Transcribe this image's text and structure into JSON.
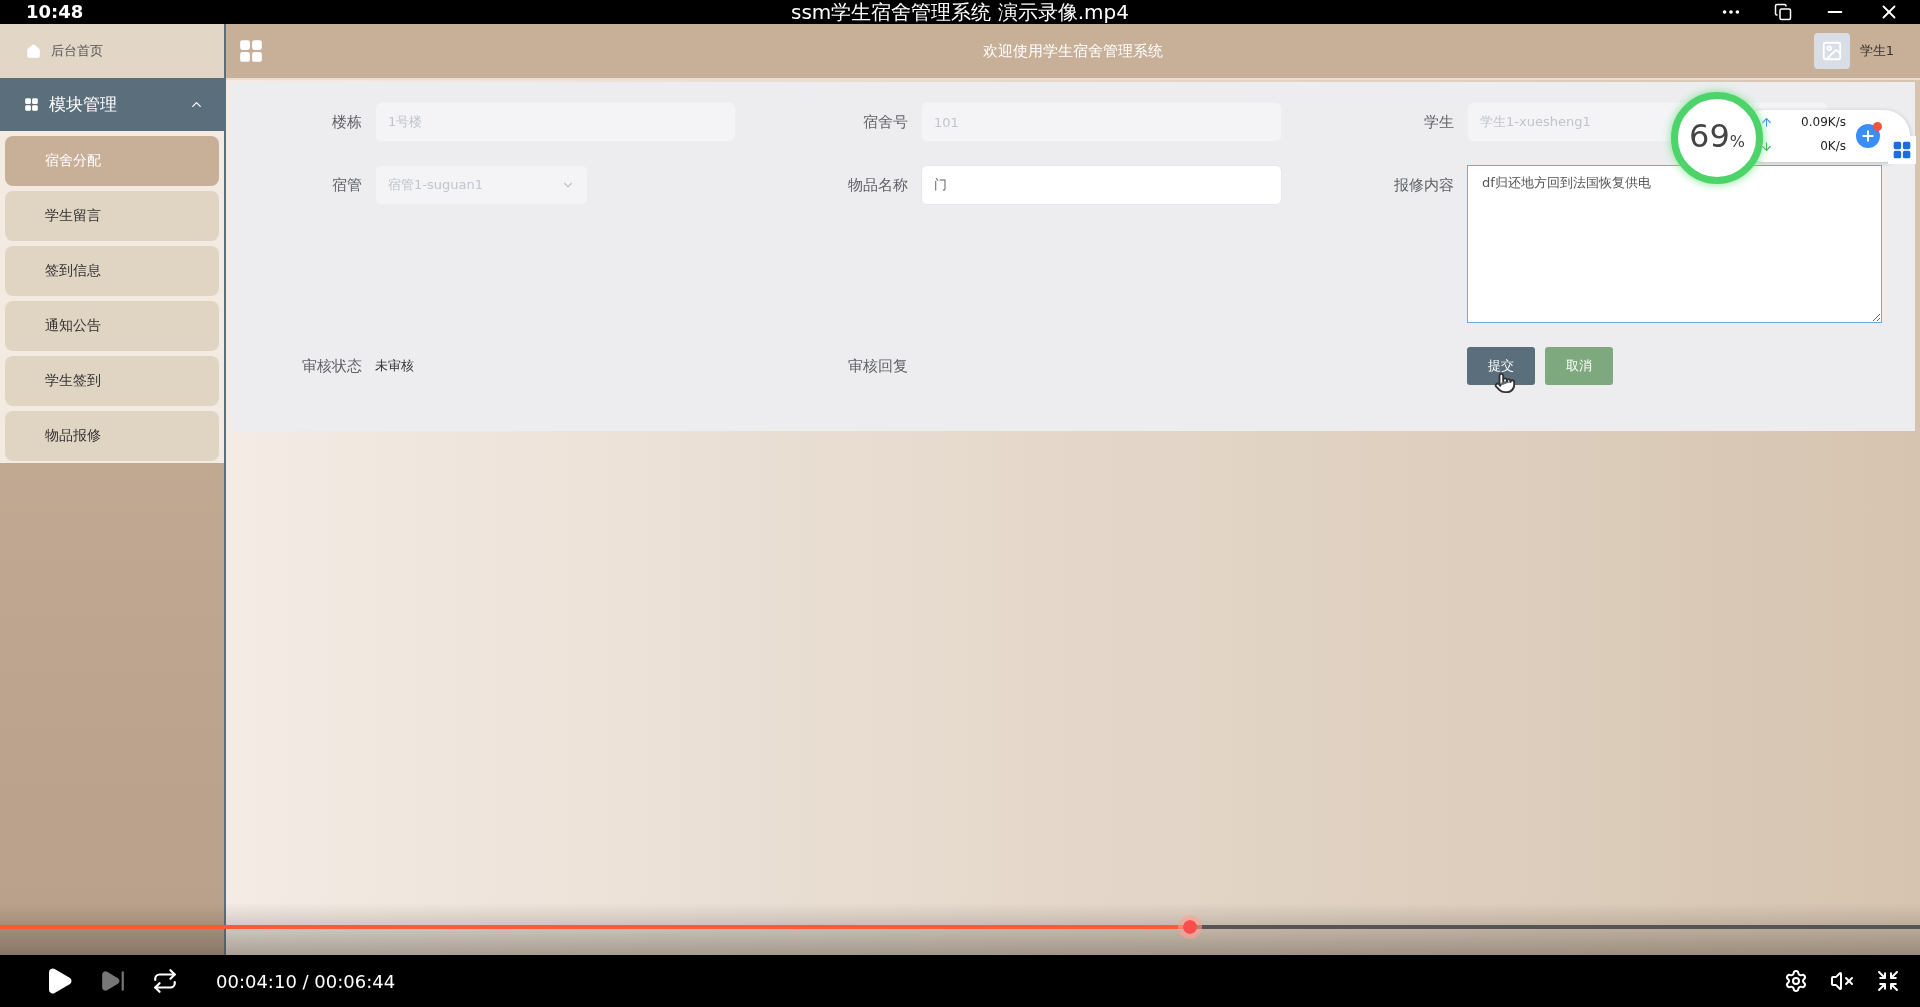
{
  "player": {
    "clock": "10:48",
    "title": "ssm学生宿舍管理系统 演示录像.mp4",
    "time": "00:04:10 / 00:06:44",
    "progress": {
      "level": 0.62
    },
    "playing": false,
    "muted": true
  },
  "sidebar": {
    "home": "后台首页",
    "section": {
      "label": "模块管理",
      "expanded": true
    },
    "items": [
      {
        "label": "宿舍分配",
        "selected": true
      },
      {
        "label": "学生留言",
        "selected": false
      },
      {
        "label": "签到信息",
        "selected": false
      },
      {
        "label": "通知公告",
        "selected": false
      },
      {
        "label": "学生签到",
        "selected": false
      },
      {
        "label": "物品报修",
        "selected": false
      }
    ]
  },
  "header": {
    "title": "欢迎使用学生宿舍管理系统",
    "user": "学生1"
  },
  "form": {
    "fields": [
      {
        "kind": "input",
        "label": "楼栋",
        "value": "1号楼",
        "disabled": true
      },
      {
        "kind": "input",
        "label": "宿舍号",
        "value": "101",
        "disabled": true
      },
      {
        "kind": "select",
        "label": "学生",
        "value": "学生1-xuesheng1",
        "disabled": true
      },
      {
        "kind": "select",
        "label": "宿管",
        "value": "宿管1-suguan1",
        "disabled": true
      },
      {
        "kind": "input",
        "label": "物品名称",
        "value": "门",
        "disabled": false
      },
      {
        "kind": "textarea",
        "label": "报修内容",
        "value": "df归还地方回到法国恢复供电",
        "disabled": false
      },
      {
        "kind": "text",
        "label": "审核状态",
        "value": "未审核"
      },
      {
        "kind": "text",
        "label": "审核回复"
      }
    ],
    "buttons": [
      {
        "kind": "primary",
        "label": "提交"
      },
      {
        "kind": "secondary",
        "label": "取消"
      }
    ]
  },
  "speed_widget": {
    "percent": "69",
    "unit": "%",
    "upload": "0.09K/s",
    "download": "0K/s"
  }
}
